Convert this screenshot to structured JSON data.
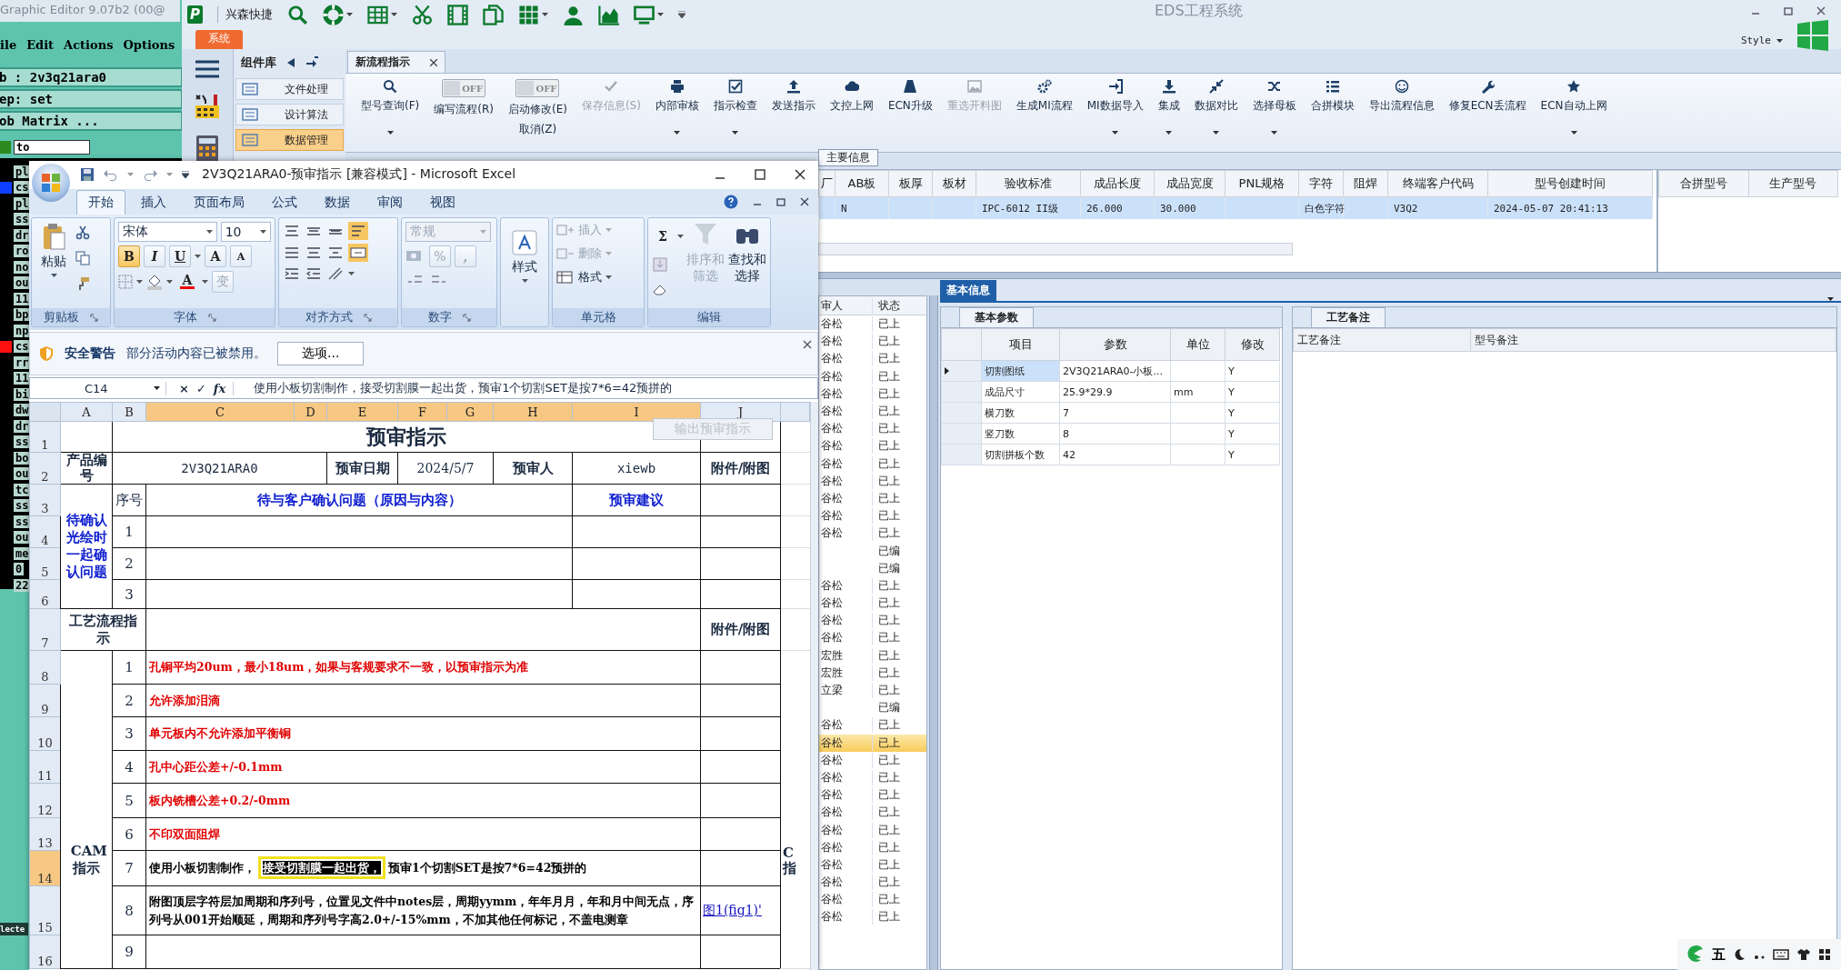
{
  "graphic_editor": {
    "title": "Graphic Editor 9.07b2 (00@",
    "menu": [
      "ile",
      "Edit",
      "Actions",
      "Options"
    ],
    "fields": [
      "b : 2v3q21ara0",
      "ep: set",
      "ob Matrix ..."
    ],
    "filter": "to",
    "layers": [
      {
        "name": "pl"
      },
      {
        "name": "cs",
        "color": "#1040ff"
      },
      {
        "name": "pl"
      },
      {
        "name": "ss"
      },
      {
        "name": "dr"
      },
      {
        "name": "ro"
      },
      {
        "name": "no"
      },
      {
        "name": "ou"
      },
      {
        "name": "11"
      },
      {
        "name": "bp"
      },
      {
        "name": "np"
      },
      {
        "name": "cs",
        "color": "#ff1010"
      },
      {
        "name": "rr"
      },
      {
        "name": "11"
      },
      {
        "name": "bi"
      },
      {
        "name": "dw"
      },
      {
        "name": "dr"
      },
      {
        "name": "ss"
      },
      {
        "name": "bo"
      },
      {
        "name": "ou"
      },
      {
        "name": "tc"
      },
      {
        "name": "ss"
      },
      {
        "name": "ss"
      },
      {
        "name": "ou"
      },
      {
        "name": "me"
      },
      {
        "name": "0"
      },
      {
        "name": "22"
      }
    ],
    "status": "lecte"
  },
  "eds": {
    "logo": "P",
    "quick_title": "兴森快捷",
    "title": "EDS工程系统",
    "style_label": "Style",
    "system_tab": "系统",
    "sidebar": {
      "title": "组件库",
      "items": [
        {
          "label": "文件处理",
          "selected": false
        },
        {
          "label": "设计算法",
          "selected": false
        },
        {
          "label": "数据管理",
          "selected": true
        }
      ]
    },
    "doc_tab": "新流程指示",
    "ribbon": [
      {
        "kind": "button",
        "label": "型号查询(F)",
        "disabled": false,
        "dropdown": true
      },
      {
        "kind": "toggle",
        "label": "编写流程(R)",
        "switch": "OFF",
        "on": false
      },
      {
        "kind": "toggle",
        "label": "启动修改(E)",
        "sublabel": "取消(Z)",
        "switch": "OFF",
        "on": false
      },
      {
        "kind": "button",
        "label": "保存信息(S)",
        "disabled": true,
        "dropdown": false
      },
      {
        "kind": "button",
        "label": "内部审核",
        "disabled": false,
        "dropdown": true
      },
      {
        "kind": "button",
        "label": "指示检查",
        "disabled": false,
        "dropdown": true
      },
      {
        "kind": "button",
        "label": "发送指示",
        "disabled": false,
        "dropdown": false
      },
      {
        "kind": "button",
        "label": "文控上网",
        "disabled": false,
        "dropdown": false
      },
      {
        "kind": "button",
        "label": "ECN升级",
        "disabled": false,
        "dropdown": false
      },
      {
        "kind": "button",
        "label": "重选开料图",
        "disabled": true,
        "dropdown": false
      },
      {
        "kind": "button",
        "label": "生成MI流程",
        "disabled": false,
        "dropdown": false
      },
      {
        "kind": "button",
        "label": "MI数据导入",
        "disabled": false,
        "dropdown": true
      },
      {
        "kind": "button",
        "label": "集成",
        "disabled": false,
        "dropdown": true
      },
      {
        "kind": "button",
        "label": "数据对比",
        "disabled": false,
        "dropdown": true
      },
      {
        "kind": "button",
        "label": "选择母板",
        "disabled": false,
        "dropdown": true
      },
      {
        "kind": "button",
        "label": "合拼模块",
        "disabled": false,
        "dropdown": false
      },
      {
        "kind": "button",
        "label": "导出流程信息",
        "disabled": false,
        "dropdown": false
      },
      {
        "kind": "button",
        "label": "修复ECN丢流程",
        "disabled": false,
        "dropdown": false
      },
      {
        "kind": "button",
        "label": "ECN自动上网",
        "disabled": false,
        "dropdown": true
      }
    ],
    "group_label": "主要信息",
    "grid": {
      "columns": [
        "厂",
        "AB板",
        "板厚",
        "板材",
        "验收标准",
        "成品长度",
        "成品宽度",
        "PNL规格",
        "字符",
        "阻焊",
        "终端客户代码",
        "型号创建时间"
      ],
      "rows": [
        {
          "cells": [
            "",
            "N",
            "",
            "",
            "IPC-6012 II级",
            "26.000",
            "30.000",
            "",
            "白色字符",
            "",
            "V3Q2",
            "2024-05-07 20:41:13"
          ],
          "selected": true
        }
      ]
    },
    "side_grid": {
      "columns": [
        "合拼型号",
        "生产型号"
      ]
    },
    "list": {
      "columns": [
        "审人",
        "状态"
      ],
      "rows": [
        {
          "reviewer": "谷松",
          "status": "已上",
          "selected": false
        },
        {
          "reviewer": "谷松",
          "status": "已上",
          "selected": false
        },
        {
          "reviewer": "谷松",
          "status": "已上",
          "selected": false
        },
        {
          "reviewer": "谷松",
          "status": "已上",
          "selected": false
        },
        {
          "reviewer": "谷松",
          "status": "已上",
          "selected": false
        },
        {
          "reviewer": "谷松",
          "status": "已上",
          "selected": false
        },
        {
          "reviewer": "谷松",
          "status": "已上",
          "selected": false
        },
        {
          "reviewer": "谷松",
          "status": "已上",
          "selected": false
        },
        {
          "reviewer": "谷松",
          "status": "已上",
          "selected": false
        },
        {
          "reviewer": "谷松",
          "status": "已上",
          "selected": false
        },
        {
          "reviewer": "谷松",
          "status": "已上",
          "selected": false
        },
        {
          "reviewer": "谷松",
          "status": "已上",
          "selected": false
        },
        {
          "reviewer": "谷松",
          "status": "已上",
          "selected": false
        },
        {
          "status": "已编",
          "selected": false
        },
        {
          "status": "已编",
          "selected": false
        },
        {
          "reviewer": "谷松",
          "status": "已上",
          "selected": false
        },
        {
          "reviewer": "谷松",
          "status": "已上",
          "selected": false
        },
        {
          "reviewer": "谷松",
          "status": "已上",
          "selected": false
        },
        {
          "reviewer": "谷松",
          "status": "已上",
          "selected": false
        },
        {
          "reviewer": "宏胜",
          "status": "已上",
          "selected": false
        },
        {
          "reviewer": "宏胜",
          "status": "已上",
          "selected": false
        },
        {
          "reviewer": "立梁",
          "status": "已上",
          "selected": false
        },
        {
          "status": "已编",
          "selected": false
        },
        {
          "reviewer": "谷松",
          "status": "已上",
          "selected": false
        },
        {
          "reviewer": "谷松",
          "status": "已上",
          "selected": true
        },
        {
          "reviewer": "谷松",
          "status": "已上",
          "selected": false
        },
        {
          "reviewer": "谷松",
          "status": "已上",
          "selected": false
        },
        {
          "reviewer": "谷松",
          "status": "已上",
          "selected": false
        },
        {
          "reviewer": "谷松",
          "status": "已上",
          "selected": false
        },
        {
          "reviewer": "谷松",
          "status": "已上",
          "selected": false
        },
        {
          "reviewer": "谷松",
          "status": "已上",
          "selected": false
        },
        {
          "reviewer": "谷松",
          "status": "已上",
          "selected": false
        },
        {
          "reviewer": "谷松",
          "status": "已上",
          "selected": false
        },
        {
          "reviewer": "谷松",
          "status": "已上",
          "selected": false
        },
        {
          "reviewer": "谷松",
          "status": "已上",
          "selected": false
        }
      ]
    },
    "info": {
      "tab": "基本信息",
      "params_tab": "基本参数",
      "params_columns": [
        "项目",
        "参数",
        "单位",
        "修改"
      ],
      "params": [
        {
          "item": "切割图纸",
          "value": "2V3Q21ARA0-小板...",
          "modified": "Y",
          "selected": true
        },
        {
          "item": "成品尺寸",
          "value": "25.9*29.9",
          "unit": "mm",
          "modified": "Y",
          "selected": false
        },
        {
          "item": "横刀数",
          "value": "7",
          "modified": "Y",
          "selected": false
        },
        {
          "item": "竖刀数",
          "value": "8",
          "modified": "Y",
          "selected": false
        },
        {
          "item": "切割拼板个数",
          "value": "42",
          "modified": "Y",
          "selected": false
        }
      ],
      "notes_tab": "工艺备注",
      "notes_columns": [
        "工艺备注",
        "型号备注"
      ]
    }
  },
  "excel": {
    "title": "2V3Q21ARA0-预审指示  [兼容模式] - Microsoft Excel",
    "tabs": [
      {
        "label": "开始",
        "selected": true
      },
      {
        "label": "插入",
        "selected": false
      },
      {
        "label": "页面布局",
        "selected": false
      },
      {
        "label": "公式",
        "selected": false
      },
      {
        "label": "数据",
        "selected": false
      },
      {
        "label": "审阅",
        "selected": false
      },
      {
        "label": "视图",
        "selected": false
      }
    ],
    "ribbon": {
      "paste": "粘贴",
      "font": "宋体",
      "size": "10",
      "bold": "B",
      "italic": "I",
      "underline": "U",
      "grow": "A",
      "shrink": "A",
      "font_color": "A",
      "phonetic": "变",
      "number_format": "常规",
      "percent": "%",
      "comma": ",",
      "styles": "样式",
      "insert": "插入",
      "delete": "删除",
      "format": "格式",
      "sum": "Σ",
      "sort": "排序和筛选",
      "find": "查找和选择",
      "groups": [
        "剪贴板",
        "字体",
        "对齐方式",
        "数字",
        "单元格",
        "编辑"
      ]
    },
    "security": {
      "title": "安全警告",
      "message": "部分活动内容已被禁用。",
      "button": "选项..."
    },
    "formula_bar": {
      "cell": "C14",
      "cancel": "×",
      "enter": "✓",
      "fx": "fx",
      "formula": "使用小板切割制作，接受切割膜一起出货，预审1个切割SET是按7*6=42预拼的"
    },
    "columns": [
      {
        "label": "A",
        "selected": false
      },
      {
        "label": "B",
        "selected": false
      },
      {
        "label": "C",
        "selected": true
      },
      {
        "label": "D",
        "selected": true
      },
      {
        "label": "E",
        "selected": true
      },
      {
        "label": "F",
        "selected": true
      },
      {
        "label": "G",
        "selected": true
      },
      {
        "label": "H",
        "selected": true
      },
      {
        "label": "I",
        "selected": true
      },
      {
        "label": "J",
        "selected": false
      }
    ],
    "rows": [
      {
        "label": "1",
        "selected": false
      },
      {
        "label": "2",
        "selected": false
      },
      {
        "label": "3",
        "selected": false
      },
      {
        "label": "4",
        "selected": false
      },
      {
        "label": "5",
        "selected": false
      },
      {
        "label": "6",
        "selected": false
      },
      {
        "label": "7",
        "selected": false
      },
      {
        "label": "8",
        "selected": false
      },
      {
        "label": "9",
        "selected": false
      },
      {
        "label": "10",
        "selected": false
      },
      {
        "label": "11",
        "selected": false
      },
      {
        "label": "12",
        "selected": false
      },
      {
        "label": "13",
        "selected": false
      },
      {
        "label": "14",
        "selected": true
      },
      {
        "label": "15",
        "selected": false
      },
      {
        "label": "16",
        "selected": false
      }
    ],
    "sheet": {
      "title": "预审指示",
      "export_button": "输出预审指示",
      "product_label": "产品编号",
      "product": "2V3Q21ARA0",
      "date_label": "预审日期",
      "date": "2024/5/7",
      "reviewer_label": "预审人",
      "reviewer": "xiewb",
      "attach_label": "附件/附图",
      "confirm_label": "待确认光绘时一起确认问题",
      "seq_label": "序号",
      "question_header": "待与客户确认问题（原因与内容）",
      "advice_header": "预审建议",
      "questions": [
        "1",
        "2",
        "3"
      ],
      "process_label": "工艺流程指示",
      "attach_label2": "附件/附图",
      "cam_label": "CAM指示",
      "edge_text": "C指",
      "instructions": [
        {
          "no": "1",
          "text": "孔铜平均20um，最小18um，如果与客规要求不一致，以预审指示为准",
          "color": "#e00000"
        },
        {
          "no": "2",
          "text": "允许添加泪滴",
          "color": "#e00000"
        },
        {
          "no": "3",
          "text": "单元板内不允许添加平衡铜",
          "color": "#e00000"
        },
        {
          "no": "4",
          "text": "孔中心距公差+/-0.1mm",
          "color": "#e00000"
        },
        {
          "no": "5",
          "text": "板内铣槽公差+0.2/-0mm",
          "color": "#e00000"
        },
        {
          "no": "6",
          "text": "不印双面阻焊",
          "color": "#e00000"
        },
        {
          "no": "7",
          "text": "使用小板切割制作，**接受切割膜一起出货，**预审1个切割SET是按7*6=42预拼的",
          "color": "#000000"
        },
        {
          "no": "8",
          "text": "附图顶层字符层加周期和序列号，位置见文件中notes层，周期yymm，年年月月，年和月中间无点，序列号从001开始顺延，周期和序列号字高2.0+/-15%mm，不加其他任何标记，不盖电测章",
          "color": "#000000",
          "attachment": "图1(fig1)'"
        },
        {
          "no": "9"
        }
      ]
    }
  },
  "tray": {
    "ime": "五"
  }
}
